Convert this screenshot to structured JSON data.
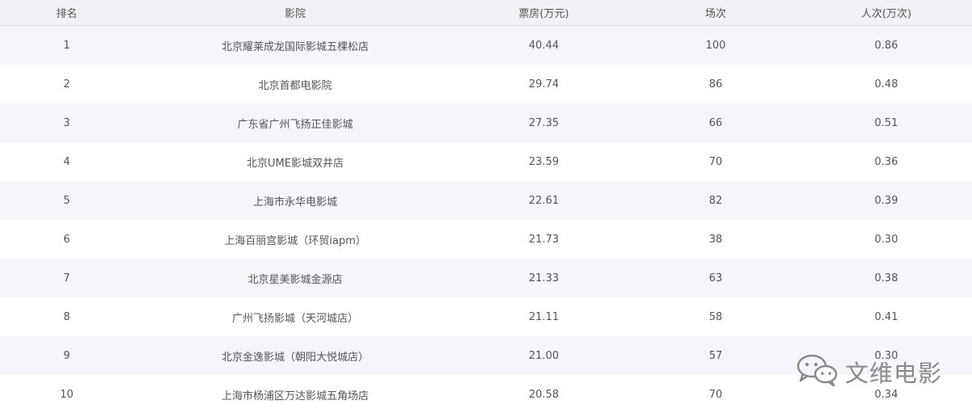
{
  "table": {
    "headers": [
      "排名",
      "影院",
      "票房(万元)",
      "场次",
      "人次(万次)"
    ],
    "rows": [
      [
        "1",
        "北京耀莱成龙国际影城五棵松店",
        "40.44",
        "100",
        "0.86"
      ],
      [
        "2",
        "北京首都电影院",
        "29.74",
        "86",
        "0.48"
      ],
      [
        "3",
        "广东省广州飞扬正佳影城",
        "27.35",
        "66",
        "0.51"
      ],
      [
        "4",
        "北京UME影城双井店",
        "23.59",
        "70",
        "0.36"
      ],
      [
        "5",
        "上海市永华电影城",
        "22.61",
        "82",
        "0.39"
      ],
      [
        "6",
        "上海百丽宫影城（环贸iapm）",
        "21.73",
        "38",
        "0.30"
      ],
      [
        "7",
        "北京星美影城金源店",
        "21.33",
        "63",
        "0.38"
      ],
      [
        "8",
        "广州飞扬影城（天河城店）",
        "21.11",
        "58",
        "0.41"
      ],
      [
        "9",
        "北京金逸影城（朝阳大悦城店）",
        "21.00",
        "57",
        "0.30"
      ],
      [
        "10",
        "上海市杨浦区万达影城五角场店",
        "20.58",
        "70",
        "0.34"
      ]
    ]
  },
  "watermark": {
    "text": "文维电影",
    "icon": "wechat-icon"
  },
  "colors": {
    "header_bg": "#f0f1f4",
    "row_alt_bg": "#f4f6fb",
    "text": "#555555"
  }
}
